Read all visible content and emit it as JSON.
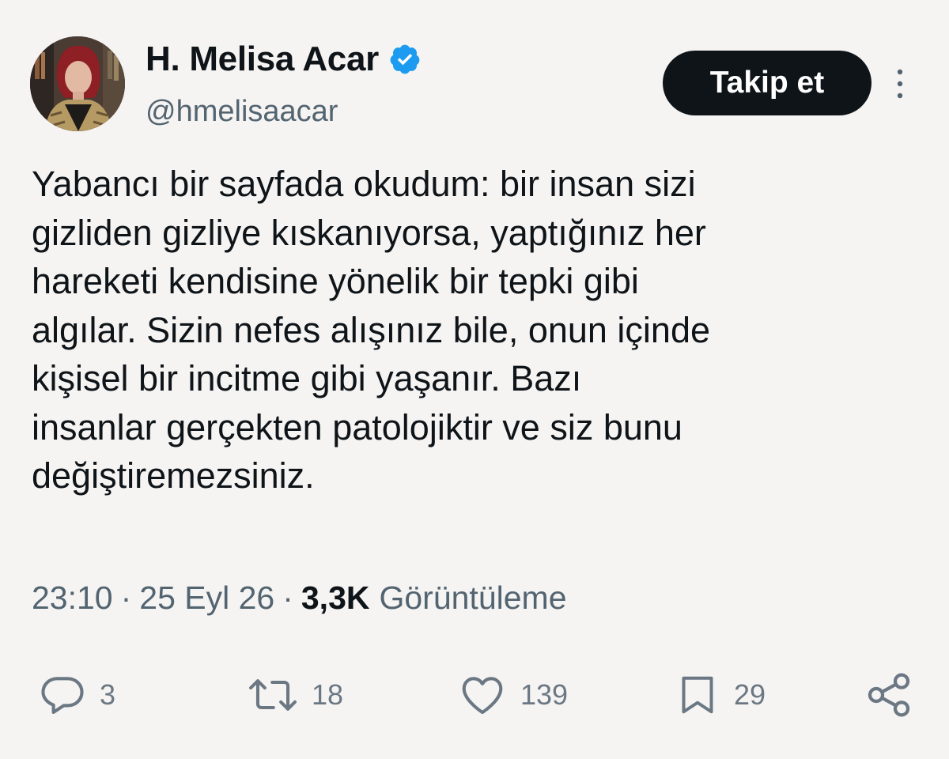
{
  "author": {
    "display_name": "H. Melisa Acar",
    "handle": "@hmelisaacar",
    "verified": true
  },
  "follow_button": {
    "label": "Takip et"
  },
  "tweet": {
    "text": "Yabancı bir sayfada okudum: bir insan sizi\ngizliden gizliye kıskanıyorsa, yaptığınız her\nhareketi kendisine yönelik bir tepki gibi\nalgılar. Sizin nefes alışınız bile, onun içinde\nkişisel bir incitme gibi yaşanır. Bazı\ninsanlar gerçekten patolojiktir ve siz bunu\ndeğiştiremezsiniz.",
    "time": "23:10",
    "date": "25 Eyl 26",
    "separator": "·",
    "views_count": "3,3K",
    "views_label": "Görüntüleme"
  },
  "actions": {
    "replies": "3",
    "reposts": "18",
    "likes": "139",
    "bookmarks": "29"
  },
  "colors": {
    "background": "#f5f4f2",
    "text": "#0f1419",
    "muted": "#536471",
    "verified": "#1d9bf0",
    "button": "#0f1419"
  },
  "icons": [
    "verified-badge-icon",
    "more-options-icon",
    "reply-icon",
    "repost-icon",
    "like-icon",
    "bookmark-icon",
    "share-icon"
  ]
}
